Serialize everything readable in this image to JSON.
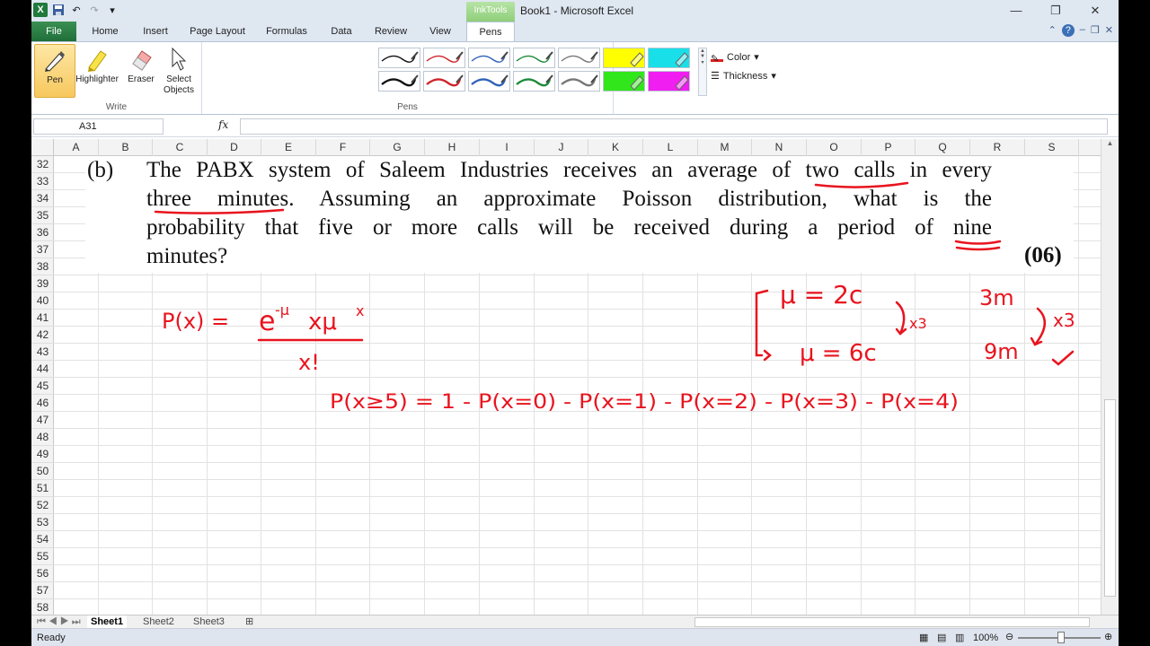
{
  "window": {
    "title": "Book1  -  Microsoft Excel",
    "context_tab": "InkTools"
  },
  "ribbon": {
    "tabs": [
      "File",
      "Home",
      "Insert",
      "Page Layout",
      "Formulas",
      "Data",
      "Review",
      "View",
      "Pens"
    ],
    "active_tab": "Pens",
    "write_group": {
      "label": "Write",
      "buttons": [
        "Pen",
        "Highlighter",
        "Eraser",
        "Select Objects"
      ]
    },
    "pens_group": {
      "label": "Pens"
    },
    "options": {
      "color": "Color",
      "thickness": "Thickness"
    }
  },
  "formula_bar": {
    "name_box": "A31",
    "fx": "fx",
    "value": ""
  },
  "columns": [
    "A",
    "B",
    "C",
    "D",
    "E",
    "F",
    "G",
    "H",
    "I",
    "J",
    "K",
    "L",
    "M",
    "N",
    "O",
    "P",
    "Q",
    "R",
    "S"
  ],
  "rows": [
    "32",
    "33",
    "34",
    "35",
    "36",
    "37",
    "38",
    "39",
    "40",
    "41",
    "42",
    "43",
    "44",
    "45",
    "46",
    "47",
    "48",
    "49",
    "50",
    "51",
    "52",
    "53",
    "54",
    "55",
    "56",
    "57",
    "58"
  ],
  "question": {
    "label": "(b)",
    "lines": [
      "The PABX system of Saleem Industries receives an average of two calls in every",
      "three minutes. Assuming an approximate Poisson distribution, what is the",
      "probability that five or more calls will be received during a period of nine",
      "minutes?"
    ],
    "marks": "(06)"
  },
  "ink": {
    "color": "#e8141e",
    "formula": "P(x) = e^-μ x μ^x / x!",
    "poisson_left": "P(x) =",
    "poisson_numerator": "e",
    "poisson_exp": "-μ",
    "poisson_times": "xμ",
    "poisson_exp2": "x",
    "poisson_denominator": "x!",
    "mu1": "μ = 2c",
    "mu2": "μ = 6c",
    "scale1": "x3",
    "time1": "3m",
    "time2": "9m",
    "scale2": "x3",
    "complement": "P(x≥5) = 1 - P(x=0) - P(x=1) - P(x=2) - P(x=3) - P(x=4)"
  },
  "sheets": [
    "Sheet1",
    "Sheet2",
    "Sheet3"
  ],
  "active_sheet": "Sheet1",
  "status": {
    "text": "Ready",
    "zoom": "100%"
  }
}
